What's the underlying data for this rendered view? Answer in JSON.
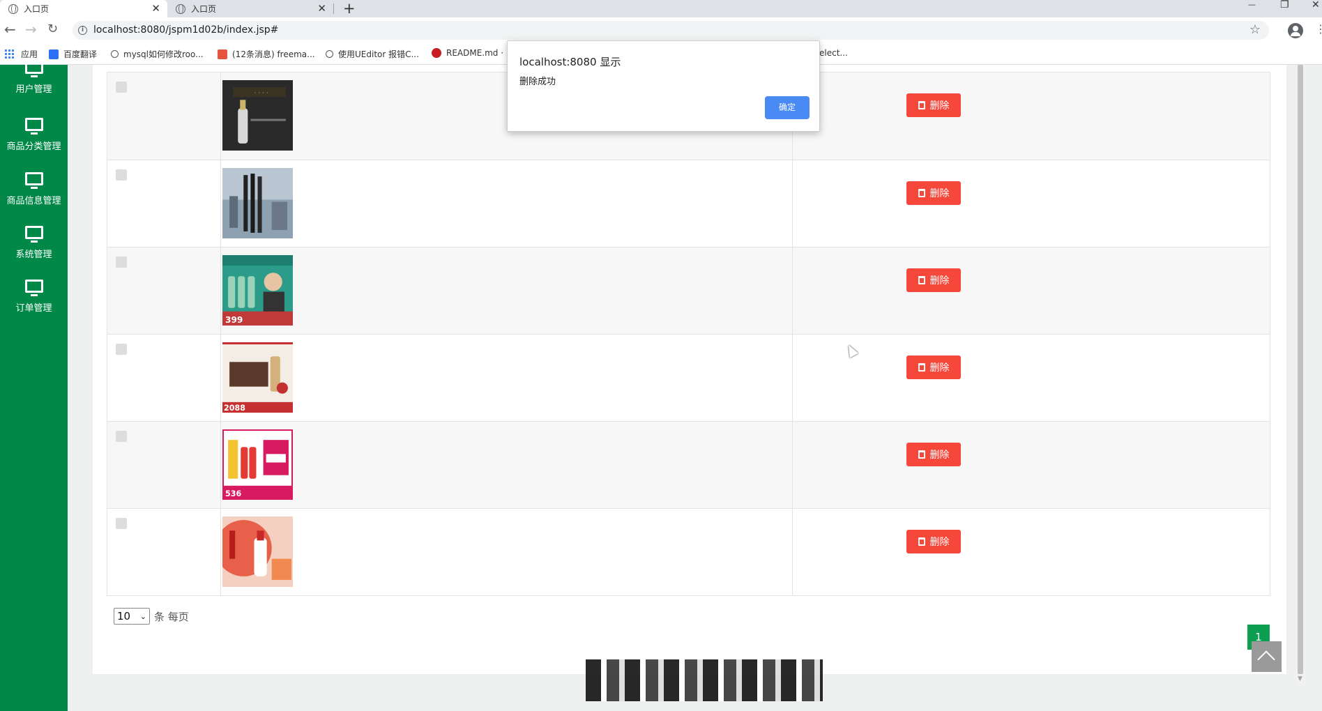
{
  "browser": {
    "tabs": [
      {
        "title": "入口页",
        "active": true
      },
      {
        "title": "入口页",
        "active": false
      }
    ],
    "new_tab": "+",
    "url": "localhost:8080/jspm1d02b/index.jsp#",
    "window_controls": {
      "minimize": "—",
      "restore": "❐",
      "close": "✕"
    },
    "bookmarks": [
      {
        "label": "应用",
        "icon": "apps-grid-icon"
      },
      {
        "label": "百度翻译",
        "icon": "baidu-translate-icon"
      },
      {
        "label": "mysql如何修改roo...",
        "icon": "bookmark-icon"
      },
      {
        "label": "(12条消息) freema...",
        "icon": "csdn-icon"
      },
      {
        "label": "使用UEditor 报错C...",
        "icon": "bookmark-icon"
      },
      {
        "label": "README.md ·",
        "icon": "gitee-icon"
      },
      {
        "label": "elect...",
        "icon": "bookmark-icon"
      }
    ]
  },
  "sidebar": {
    "items": [
      {
        "label": "用户管理",
        "icon": "monitor-icon"
      },
      {
        "label": "商品分类管理",
        "icon": "monitor-icon"
      },
      {
        "label": "商品信息管理",
        "icon": "monitor-icon"
      },
      {
        "label": "系统管理",
        "icon": "monitor-icon"
      },
      {
        "label": "订单管理",
        "icon": "monitor-icon"
      }
    ]
  },
  "table": {
    "delete_label": "删除",
    "rows": [
      {
        "image": "baijiu-bottle-dark-poster"
      },
      {
        "image": "city-skyline-poster"
      },
      {
        "image": "green-bottles-with-man-399"
      },
      {
        "image": "liquor-gift-box-2088"
      },
      {
        "image": "red-liquor-promo-536"
      },
      {
        "image": "moutai-bottle-red-poster"
      }
    ]
  },
  "pagination": {
    "page_size": "10",
    "page_size_suffix": "条 每页",
    "current_page": "1"
  },
  "dialog": {
    "title": "localhost:8080 显示",
    "message": "删除成功",
    "ok_label": "确定"
  },
  "colors": {
    "sidebar": "#008848",
    "delete_button": "#f5483a",
    "page_active": "#0c9f51",
    "dialog_ok": "#4a8af4"
  }
}
